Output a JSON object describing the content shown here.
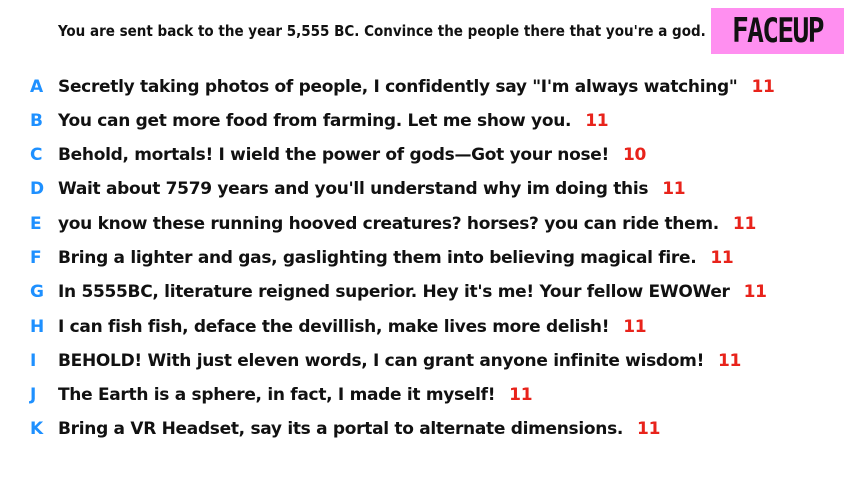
{
  "prompt": "You are sent back to the year 5,555 BC. Convince the people there that you're a god.",
  "brand": {
    "logo_text": "FACEUP",
    "logo_bg": "#ff8ff0"
  },
  "colors": {
    "letter": "#1e90ff",
    "count": "#e8231b",
    "text": "#111111"
  },
  "entries": [
    {
      "letter": "A",
      "text": "Secretly taking photos of people, I confidently say \"I'm always watching\"",
      "count": "11"
    },
    {
      "letter": "B",
      "text": "You can get more food from farming. Let me show you.",
      "count": "11"
    },
    {
      "letter": "C",
      "text": "Behold, mortals! I wield the power of gods—Got your nose!",
      "count": "10"
    },
    {
      "letter": "D",
      "text": "Wait about 7579 years and you'll understand why im doing this",
      "count": "11"
    },
    {
      "letter": "E",
      "text": "you know these running hooved creatures? horses? you can ride them.",
      "count": "11"
    },
    {
      "letter": "F",
      "text": "Bring a lighter and gas, gaslighting them into believing magical fire.",
      "count": "11"
    },
    {
      "letter": "G",
      "text": "In 5555BC, literature reigned superior. Hey it's me! Your fellow EWOWer",
      "count": "11"
    },
    {
      "letter": "H",
      "text": "I can fish fish, deface the devillish, make lives more delish!",
      "count": "11"
    },
    {
      "letter": "I",
      "text": "BEHOLD! With just eleven words, I can grant anyone infinite wisdom!",
      "count": "11"
    },
    {
      "letter": "J",
      "text": "The Earth is a sphere, in fact, I made it myself!",
      "count": "11"
    },
    {
      "letter": "K",
      "text": "Bring a VR Headset, say its a portal to alternate dimensions.",
      "count": "11"
    }
  ]
}
